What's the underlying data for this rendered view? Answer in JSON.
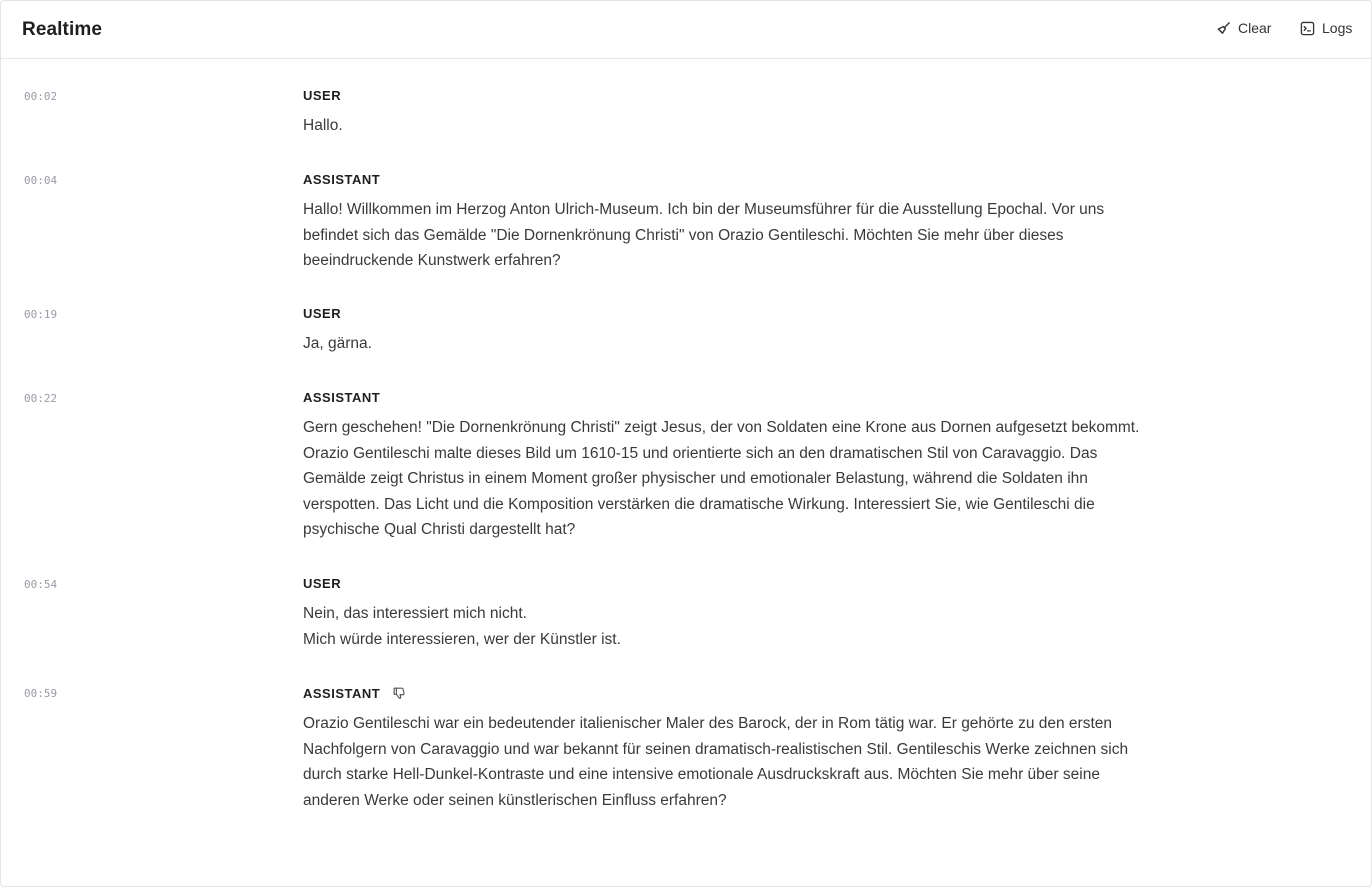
{
  "header": {
    "title": "Realtime",
    "clear_label": "Clear",
    "logs_label": "Logs"
  },
  "messages": [
    {
      "time": "00:02",
      "role": "USER",
      "lines": [
        "Hallo."
      ]
    },
    {
      "time": "00:04",
      "role": "ASSISTANT",
      "lines": [
        "Hallo! Willkommen im Herzog Anton Ulrich-Museum. Ich bin der Museumsführer für die Ausstellung Epochal. Vor uns befindet sich das Gemälde \"Die Dornenkrönung Christi\" von Orazio Gentileschi. Möchten Sie mehr über dieses beeindruckende Kunstwerk erfahren?"
      ]
    },
    {
      "time": "00:19",
      "role": "USER",
      "lines": [
        "Ja, gärna."
      ]
    },
    {
      "time": "00:22",
      "role": "ASSISTANT",
      "lines": [
        "Gern geschehen! \"Die Dornenkrönung Christi\" zeigt Jesus, der von Soldaten eine Krone aus Dornen aufgesetzt bekommt. Orazio Gentileschi malte dieses Bild um 1610-15 und orientierte sich an den dramatischen Stil von Caravaggio. Das Gemälde zeigt Christus in einem Moment großer physischer und emotionaler Belastung, während die Soldaten ihn verspotten. Das Licht und die Komposition verstärken die dramatische Wirkung. Interessiert Sie, wie Gentileschi die psychische Qual Christi dargestellt hat?"
      ]
    },
    {
      "time": "00:54",
      "role": "USER",
      "lines": [
        "Nein, das interessiert mich nicht.",
        "Mich würde interessieren, wer der Künstler ist."
      ]
    },
    {
      "time": "00:59",
      "role": "ASSISTANT",
      "lines": [
        "Orazio Gentileschi war ein bedeutender italienischer Maler des Barock, der in Rom tätig war. Er gehörte zu den ersten Nachfolgern von Caravaggio und war bekannt für seinen dramatisch-realistischen Stil. Gentileschis Werke zeichnen sich durch starke Hell-Dunkel-Kontraste und eine intensive emotionale Ausdruckskraft aus. Möchten Sie mehr über seine anderen Werke oder seinen künstlerischen Einfluss erfahren?"
      ],
      "feedback_icon": "thumbs-down-icon"
    }
  ]
}
